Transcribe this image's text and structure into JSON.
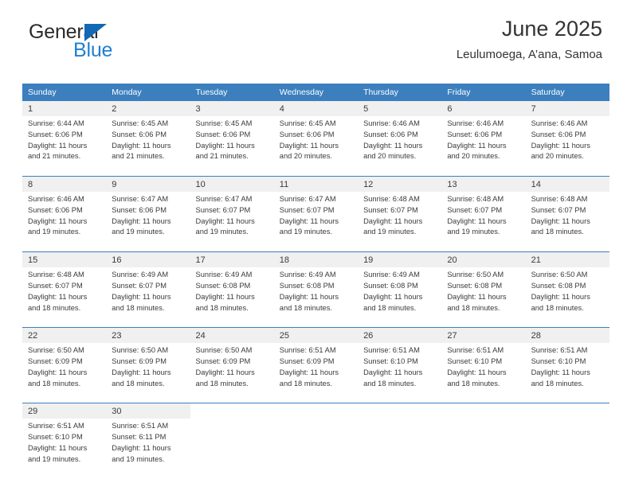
{
  "brand": {
    "name_part1": "General",
    "name_part2": "Blue",
    "accent_color": "#1268b3",
    "blue_text_color": "#1f7fd0",
    "triangle_icon": "triangle-icon"
  },
  "header": {
    "title": "June 2025",
    "subtitle": "Leulumoega, A’ana, Samoa"
  },
  "calendar": {
    "header_bg": "#3b7fbe",
    "header_text_color": "#ffffff",
    "daynum_bg": "#f0f0f0",
    "weekdays": [
      "Sunday",
      "Monday",
      "Tuesday",
      "Wednesday",
      "Thursday",
      "Friday",
      "Saturday"
    ],
    "weeks": [
      [
        {
          "day": "1",
          "sunrise": "Sunrise: 6:44 AM",
          "sunset": "Sunset: 6:06 PM",
          "daylight_line1": "Daylight: 11 hours",
          "daylight_line2": "and 21 minutes."
        },
        {
          "day": "2",
          "sunrise": "Sunrise: 6:45 AM",
          "sunset": "Sunset: 6:06 PM",
          "daylight_line1": "Daylight: 11 hours",
          "daylight_line2": "and 21 minutes."
        },
        {
          "day": "3",
          "sunrise": "Sunrise: 6:45 AM",
          "sunset": "Sunset: 6:06 PM",
          "daylight_line1": "Daylight: 11 hours",
          "daylight_line2": "and 21 minutes."
        },
        {
          "day": "4",
          "sunrise": "Sunrise: 6:45 AM",
          "sunset": "Sunset: 6:06 PM",
          "daylight_line1": "Daylight: 11 hours",
          "daylight_line2": "and 20 minutes."
        },
        {
          "day": "5",
          "sunrise": "Sunrise: 6:46 AM",
          "sunset": "Sunset: 6:06 PM",
          "daylight_line1": "Daylight: 11 hours",
          "daylight_line2": "and 20 minutes."
        },
        {
          "day": "6",
          "sunrise": "Sunrise: 6:46 AM",
          "sunset": "Sunset: 6:06 PM",
          "daylight_line1": "Daylight: 11 hours",
          "daylight_line2": "and 20 minutes."
        },
        {
          "day": "7",
          "sunrise": "Sunrise: 6:46 AM",
          "sunset": "Sunset: 6:06 PM",
          "daylight_line1": "Daylight: 11 hours",
          "daylight_line2": "and 20 minutes."
        }
      ],
      [
        {
          "day": "8",
          "sunrise": "Sunrise: 6:46 AM",
          "sunset": "Sunset: 6:06 PM",
          "daylight_line1": "Daylight: 11 hours",
          "daylight_line2": "and 19 minutes."
        },
        {
          "day": "9",
          "sunrise": "Sunrise: 6:47 AM",
          "sunset": "Sunset: 6:06 PM",
          "daylight_line1": "Daylight: 11 hours",
          "daylight_line2": "and 19 minutes."
        },
        {
          "day": "10",
          "sunrise": "Sunrise: 6:47 AM",
          "sunset": "Sunset: 6:07 PM",
          "daylight_line1": "Daylight: 11 hours",
          "daylight_line2": "and 19 minutes."
        },
        {
          "day": "11",
          "sunrise": "Sunrise: 6:47 AM",
          "sunset": "Sunset: 6:07 PM",
          "daylight_line1": "Daylight: 11 hours",
          "daylight_line2": "and 19 minutes."
        },
        {
          "day": "12",
          "sunrise": "Sunrise: 6:48 AM",
          "sunset": "Sunset: 6:07 PM",
          "daylight_line1": "Daylight: 11 hours",
          "daylight_line2": "and 19 minutes."
        },
        {
          "day": "13",
          "sunrise": "Sunrise: 6:48 AM",
          "sunset": "Sunset: 6:07 PM",
          "daylight_line1": "Daylight: 11 hours",
          "daylight_line2": "and 19 minutes."
        },
        {
          "day": "14",
          "sunrise": "Sunrise: 6:48 AM",
          "sunset": "Sunset: 6:07 PM",
          "daylight_line1": "Daylight: 11 hours",
          "daylight_line2": "and 18 minutes."
        }
      ],
      [
        {
          "day": "15",
          "sunrise": "Sunrise: 6:48 AM",
          "sunset": "Sunset: 6:07 PM",
          "daylight_line1": "Daylight: 11 hours",
          "daylight_line2": "and 18 minutes."
        },
        {
          "day": "16",
          "sunrise": "Sunrise: 6:49 AM",
          "sunset": "Sunset: 6:07 PM",
          "daylight_line1": "Daylight: 11 hours",
          "daylight_line2": "and 18 minutes."
        },
        {
          "day": "17",
          "sunrise": "Sunrise: 6:49 AM",
          "sunset": "Sunset: 6:08 PM",
          "daylight_line1": "Daylight: 11 hours",
          "daylight_line2": "and 18 minutes."
        },
        {
          "day": "18",
          "sunrise": "Sunrise: 6:49 AM",
          "sunset": "Sunset: 6:08 PM",
          "daylight_line1": "Daylight: 11 hours",
          "daylight_line2": "and 18 minutes."
        },
        {
          "day": "19",
          "sunrise": "Sunrise: 6:49 AM",
          "sunset": "Sunset: 6:08 PM",
          "daylight_line1": "Daylight: 11 hours",
          "daylight_line2": "and 18 minutes."
        },
        {
          "day": "20",
          "sunrise": "Sunrise: 6:50 AM",
          "sunset": "Sunset: 6:08 PM",
          "daylight_line1": "Daylight: 11 hours",
          "daylight_line2": "and 18 minutes."
        },
        {
          "day": "21",
          "sunrise": "Sunrise: 6:50 AM",
          "sunset": "Sunset: 6:08 PM",
          "daylight_line1": "Daylight: 11 hours",
          "daylight_line2": "and 18 minutes."
        }
      ],
      [
        {
          "day": "22",
          "sunrise": "Sunrise: 6:50 AM",
          "sunset": "Sunset: 6:09 PM",
          "daylight_line1": "Daylight: 11 hours",
          "daylight_line2": "and 18 minutes."
        },
        {
          "day": "23",
          "sunrise": "Sunrise: 6:50 AM",
          "sunset": "Sunset: 6:09 PM",
          "daylight_line1": "Daylight: 11 hours",
          "daylight_line2": "and 18 minutes."
        },
        {
          "day": "24",
          "sunrise": "Sunrise: 6:50 AM",
          "sunset": "Sunset: 6:09 PM",
          "daylight_line1": "Daylight: 11 hours",
          "daylight_line2": "and 18 minutes."
        },
        {
          "day": "25",
          "sunrise": "Sunrise: 6:51 AM",
          "sunset": "Sunset: 6:09 PM",
          "daylight_line1": "Daylight: 11 hours",
          "daylight_line2": "and 18 minutes."
        },
        {
          "day": "26",
          "sunrise": "Sunrise: 6:51 AM",
          "sunset": "Sunset: 6:10 PM",
          "daylight_line1": "Daylight: 11 hours",
          "daylight_line2": "and 18 minutes."
        },
        {
          "day": "27",
          "sunrise": "Sunrise: 6:51 AM",
          "sunset": "Sunset: 6:10 PM",
          "daylight_line1": "Daylight: 11 hours",
          "daylight_line2": "and 18 minutes."
        },
        {
          "day": "28",
          "sunrise": "Sunrise: 6:51 AM",
          "sunset": "Sunset: 6:10 PM",
          "daylight_line1": "Daylight: 11 hours",
          "daylight_line2": "and 18 minutes."
        }
      ],
      [
        {
          "day": "29",
          "sunrise": "Sunrise: 6:51 AM",
          "sunset": "Sunset: 6:10 PM",
          "daylight_line1": "Daylight: 11 hours",
          "daylight_line2": "and 19 minutes."
        },
        {
          "day": "30",
          "sunrise": "Sunrise: 6:51 AM",
          "sunset": "Sunset: 6:11 PM",
          "daylight_line1": "Daylight: 11 hours",
          "daylight_line2": "and 19 minutes."
        },
        {
          "day": "",
          "sunrise": "",
          "sunset": "",
          "daylight_line1": "",
          "daylight_line2": ""
        },
        {
          "day": "",
          "sunrise": "",
          "sunset": "",
          "daylight_line1": "",
          "daylight_line2": ""
        },
        {
          "day": "",
          "sunrise": "",
          "sunset": "",
          "daylight_line1": "",
          "daylight_line2": ""
        },
        {
          "day": "",
          "sunrise": "",
          "sunset": "",
          "daylight_line1": "",
          "daylight_line2": ""
        },
        {
          "day": "",
          "sunrise": "",
          "sunset": "",
          "daylight_line1": "",
          "daylight_line2": ""
        }
      ]
    ]
  }
}
